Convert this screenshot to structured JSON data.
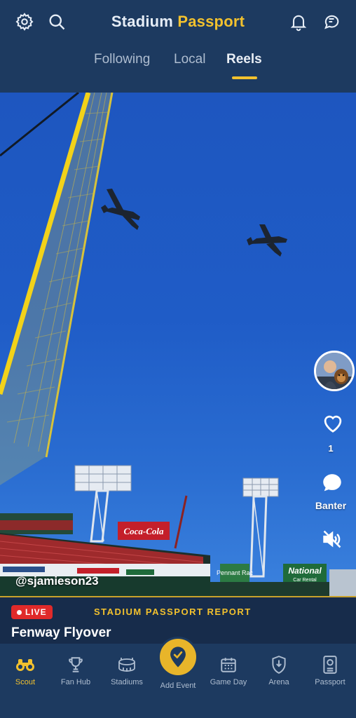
{
  "header": {
    "title_part1": "Stadium",
    "title_part2": "Passport",
    "icons": [
      "gear-icon",
      "search-icon",
      "bell-icon",
      "chat-bubbles-icon"
    ]
  },
  "tabs": [
    {
      "label": "Following",
      "active": false
    },
    {
      "label": "Local",
      "active": false
    },
    {
      "label": "Reels",
      "active": true
    }
  ],
  "reel": {
    "author_handle": "@sjamieson23",
    "like_count": "1",
    "banter_label": "Banter",
    "scene_signs": {
      "coca_cola": "Coca-Cola",
      "sign_left": "Pennant Rac",
      "sign_right": "National",
      "sign_right_sub": "Car Rental"
    }
  },
  "report": {
    "live_label": "LIVE",
    "section_label": "STADIUM PASSPORT REPORT",
    "title": "Fenway Flyover"
  },
  "nav": {
    "items": [
      {
        "label": "Scout",
        "icon": "binoculars-icon",
        "active": true
      },
      {
        "label": "Fan Hub",
        "icon": "trophy-icon",
        "active": false
      },
      {
        "label": "Stadiums",
        "icon": "stadium-icon",
        "active": false
      },
      {
        "label": "Add Event",
        "icon": "checkmark-pin-icon",
        "active": false
      },
      {
        "label": "Game Day",
        "icon": "calendar-icon",
        "active": false
      },
      {
        "label": "Arena",
        "icon": "shield-icon",
        "active": false
      },
      {
        "label": "Passport",
        "icon": "passport-icon",
        "active": false
      }
    ]
  },
  "colors": {
    "accent_gold": "#f2c12e",
    "header_navy": "#1d3a60",
    "live_red": "#e02a2a"
  }
}
